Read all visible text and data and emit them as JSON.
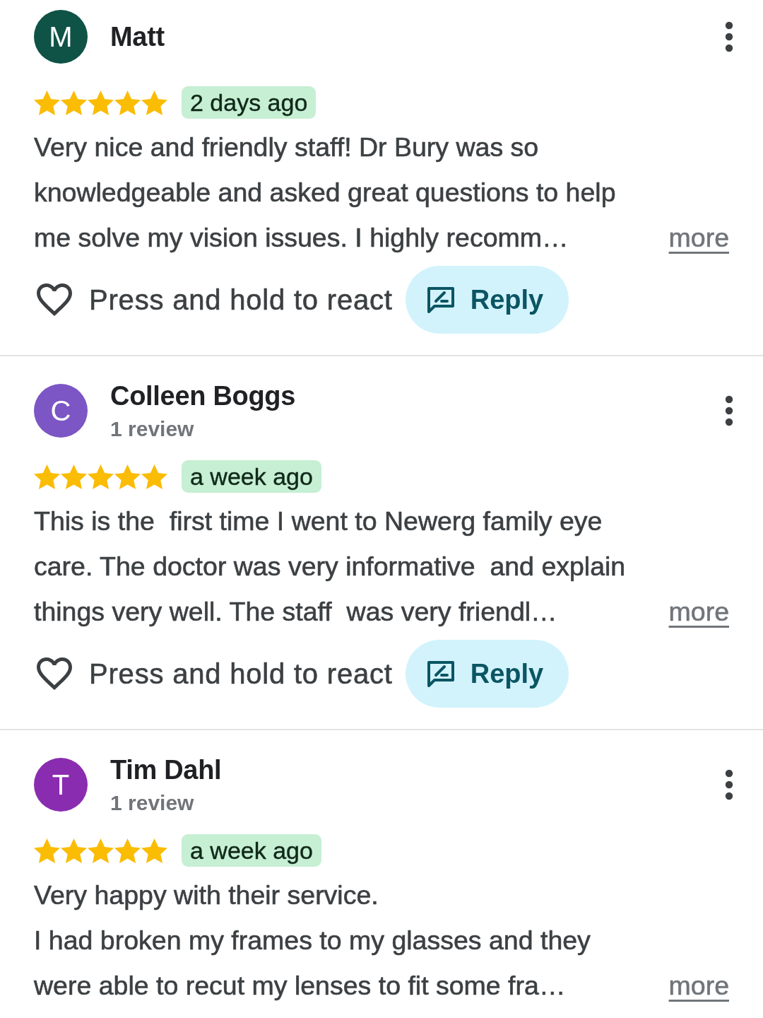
{
  "reviews": [
    {
      "avatar": {
        "letter": "M",
        "color": "#0f5246"
      },
      "name": "Matt",
      "stars": 5,
      "time": "2 days ago",
      "text": "Very nice and friendly staff! Dr Bury was so knowledgeable and asked great questions to help me solve my vision issues. I highly recomm…",
      "more": "more",
      "react": "Press and hold to react",
      "reply": "Reply"
    },
    {
      "avatar": {
        "letter": "C",
        "color": "#7b56c4"
      },
      "name": "Colleen Boggs",
      "review_count": "1 review",
      "stars": 5,
      "time": "a week ago",
      "text": "This is the  first time I went to Newerg family eye care. The doctor was very informative  and explain things very well. The staff  was very friendl…",
      "more": "more",
      "react": "Press and hold to react",
      "reply": "Reply"
    },
    {
      "avatar": {
        "letter": "T",
        "color": "#8a2cb0"
      },
      "name": "Tim Dahl",
      "review_count": "1 review",
      "stars": 5,
      "time": "a week ago",
      "text": "Very happy with their service.\nI had broken my frames to my glasses and they were able to recut my lenses to fit some fra…",
      "more": "more"
    }
  ]
}
